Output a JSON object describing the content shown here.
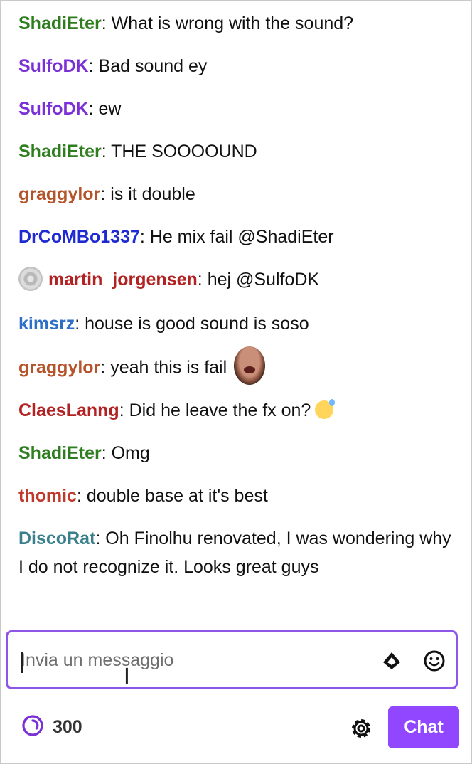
{
  "colors": {
    "accent": "#9147ff",
    "input_border": "#8f55e8",
    "ShadiEter": "#2e7d1e",
    "SulfoDK": "#7b2fd6",
    "graggylor": "#b5532a",
    "DrCoMBo1337": "#1f2bd1",
    "martin_jorgensen": "#b22222",
    "kimsrz": "#2f6fc7",
    "ClaesLanng": "#b22222",
    "thomic": "#c0392b",
    "DiscoRat": "#3a7f8c"
  },
  "messages": [
    {
      "user": "ShadiEter",
      "sep": ": ",
      "text": "What is wrong with the sound?"
    },
    {
      "user": "SulfoDK",
      "sep": ": ",
      "text": "Bad sound ey"
    },
    {
      "user": "SulfoDK",
      "sep": ": ",
      "text": "ew"
    },
    {
      "user": "ShadiEter",
      "sep": ": ",
      "text": "THE SOOOOUND"
    },
    {
      "user": "graggylor",
      "sep": ": ",
      "text": "is it double"
    },
    {
      "user": "DrCoMBo1337",
      "sep": ": ",
      "text": "He mix fail @ShadiEter"
    },
    {
      "user": "martin_jorgensen",
      "sep": ": ",
      "text": "hej @SulfoDK",
      "badge": "disc-badge-icon"
    },
    {
      "user": "kimsrz",
      "sep": ": ",
      "text": "house is good sound is soso"
    },
    {
      "user": "graggylor",
      "sep": ": ",
      "text": "yeah this is fail",
      "emote": "screaming-face-emote-icon"
    },
    {
      "user": "ClaesLanng",
      "sep": ": ",
      "text": "Did he leave the fx on?",
      "emote": "sweat-smile-emoji-icon"
    },
    {
      "user": "ShadiEter",
      "sep": ": ",
      "text": "Omg"
    },
    {
      "user": "thomic",
      "sep": ": ",
      "text": "double base at it's best"
    },
    {
      "user": "DiscoRat",
      "sep": ": ",
      "text": "Oh Finolhu renovated, I was wondering why I do not recognize it. Looks great guys"
    }
  ],
  "input": {
    "placeholder": "Invia un messaggio",
    "value": "",
    "bits_icon": "bits-diamond-icon",
    "emote_icon": "smiley-face-icon"
  },
  "footer": {
    "points_icon": "channel-points-icon",
    "points_value": "300",
    "settings_icon": "gear-icon",
    "chat_button_label": "Chat"
  }
}
